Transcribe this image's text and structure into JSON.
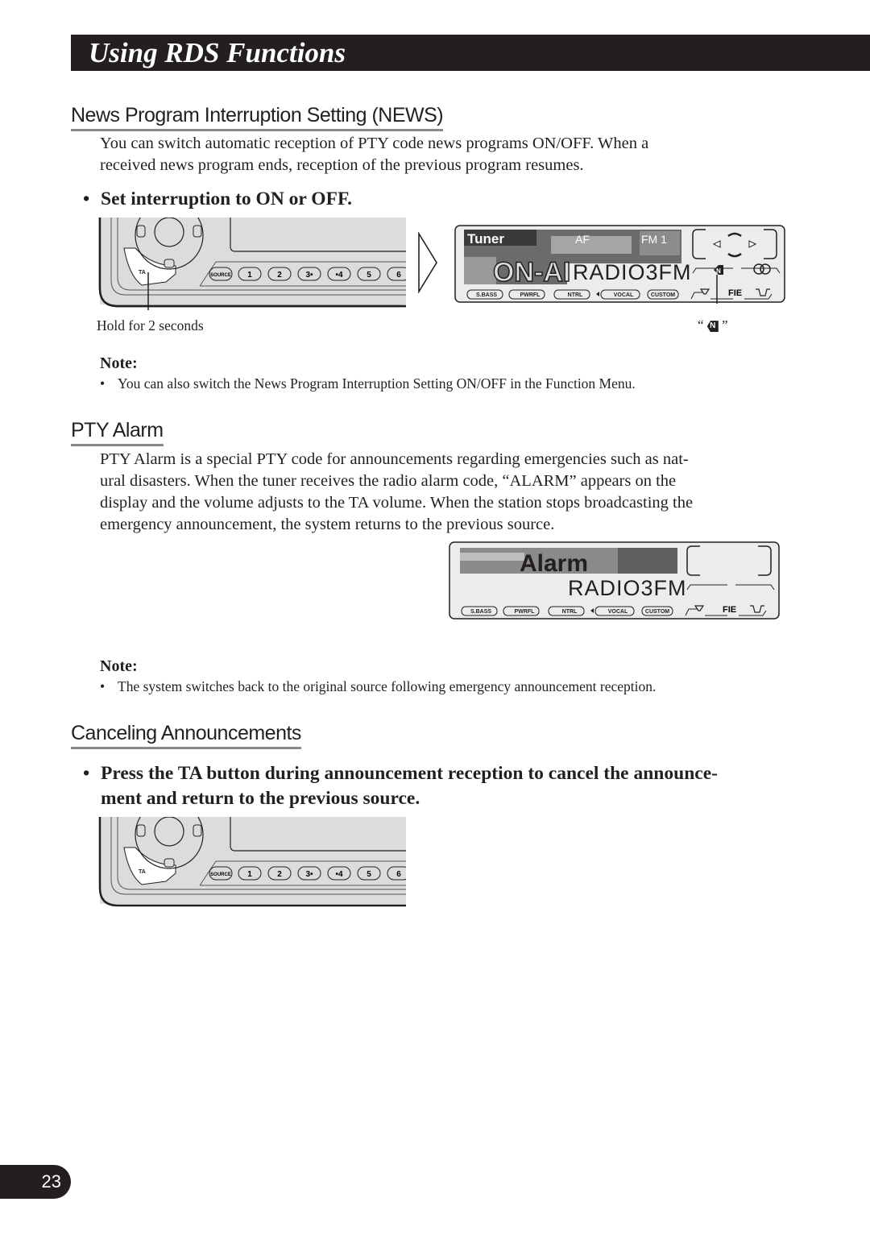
{
  "header": {
    "title": "Using RDS Functions"
  },
  "news_section": {
    "heading": "News Program Interruption Setting (NEWS)",
    "body_lines": [
      "You can switch automatic reception of PTY code news programs ON/OFF. When a",
      "received news program ends, reception of the previous program resumes."
    ],
    "instruction": "Set interruption to ON or OFF.",
    "hold_caption": "Hold for 2 seconds",
    "indicator_caption_open": "“",
    "indicator_caption_close": "”",
    "note_heading": "Note:",
    "note": "You can also switch the News Program Interruption Setting ON/OFF in the Function Menu."
  },
  "head_unit": {
    "ta_label": "TA",
    "buttons": [
      "SOURCE",
      "1",
      "2",
      "3•",
      "•4",
      "5",
      "6"
    ]
  },
  "display_news": {
    "source": "Tuner",
    "af": "AF",
    "band": "FM 1",
    "banner": "ON-AI",
    "station": "RADIO3FM",
    "news_indicator": "N",
    "eq_presets": [
      "S.BASS",
      "PWRFL",
      "NTRL",
      "VOCAL",
      "CUSTOM"
    ],
    "fie": "FIE"
  },
  "alarm_section": {
    "heading": "PTY Alarm",
    "body_lines": [
      "PTY Alarm is a special PTY code for announcements regarding emergencies such as nat-",
      "ural disasters. When the tuner receives the radio alarm code, “ALARM” appears on the",
      "display and the volume adjusts to the TA volume. When the station stops broadcasting the",
      "emergency announcement, the system returns to the previous source."
    ],
    "note_heading": "Note:",
    "note": "The system switches back to the original source following emergency announcement reception."
  },
  "display_alarm": {
    "banner": "Alarm",
    "station": "RADIO3FM",
    "eq_presets": [
      "S.BASS",
      "PWRFL",
      "NTRL",
      "VOCAL",
      "CUSTOM"
    ],
    "fie": "FIE"
  },
  "cancel_section": {
    "heading": "Canceling Announcements",
    "instruction_lines": [
      "Press the TA button during announcement reception to cancel the announce-",
      "ment and return to the previous source."
    ]
  },
  "page_number": "23"
}
